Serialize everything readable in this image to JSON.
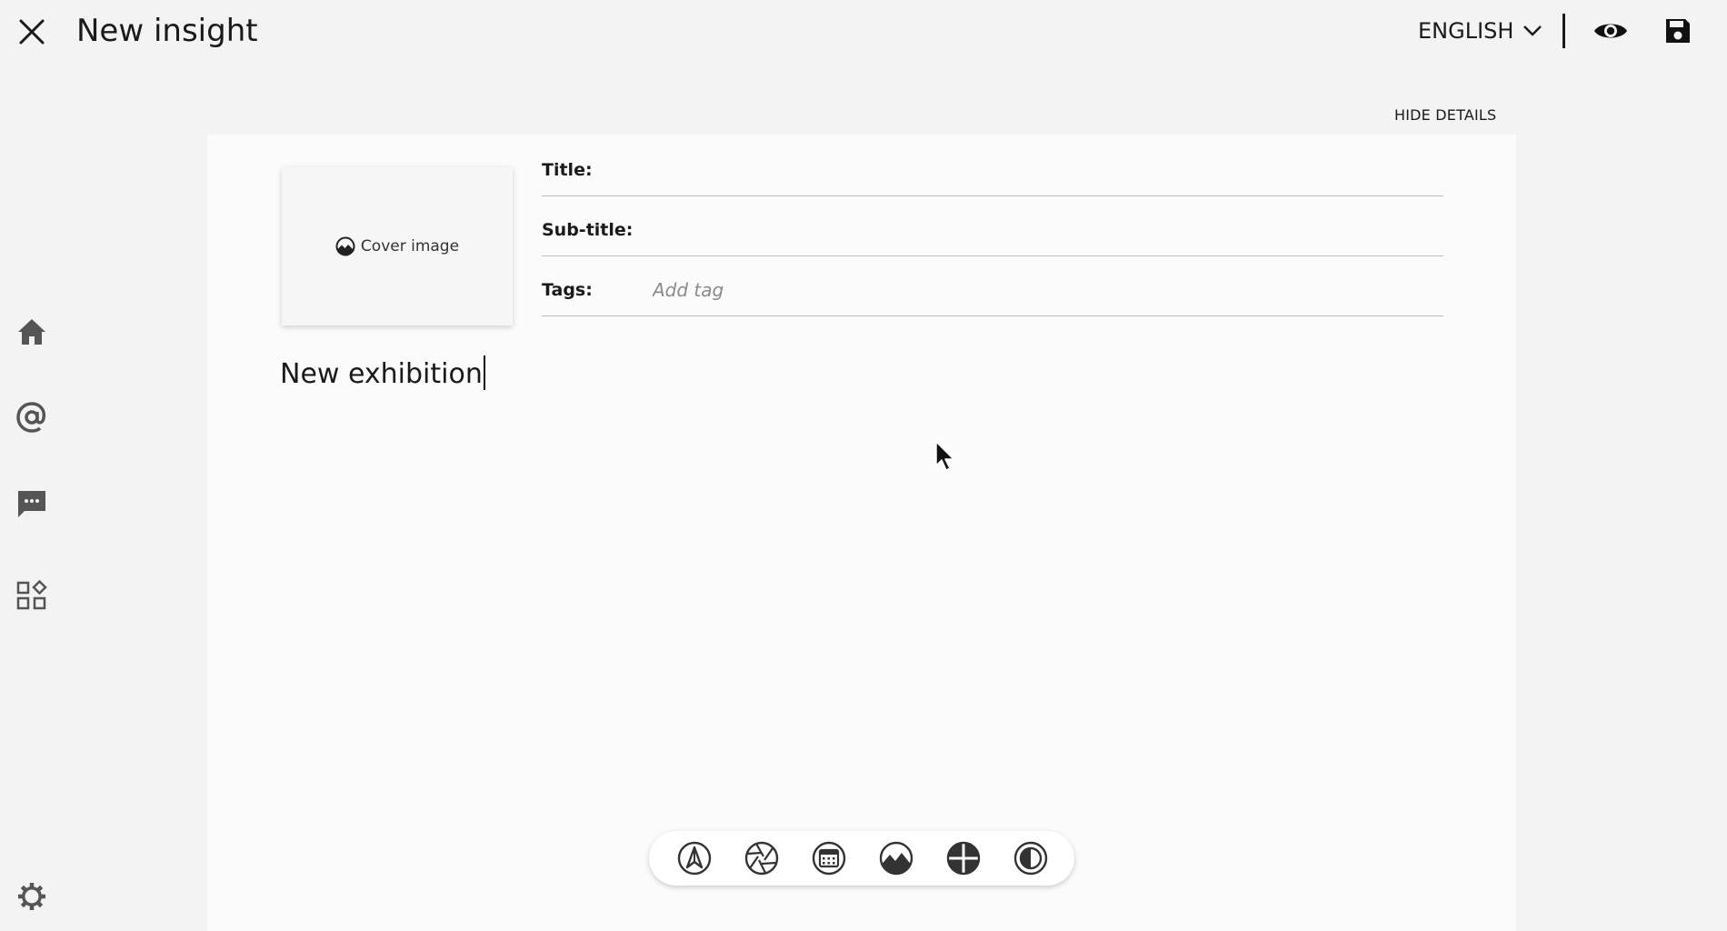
{
  "header": {
    "title": "New insight",
    "language": "ENGLISH",
    "icons": {
      "close": "close-icon",
      "chevron": "chevron-down-icon",
      "preview": "eye-icon",
      "save": "floppy-disk-icon"
    }
  },
  "sidebar": {
    "items": [
      {
        "name": "home",
        "icon": "home-icon"
      },
      {
        "name": "mentions",
        "icon": "at-sign-icon"
      },
      {
        "name": "messages",
        "icon": "chat-bubble-icon"
      },
      {
        "name": "apps",
        "icon": "apps-grid-icon"
      }
    ],
    "settings_icon": "gear-icon"
  },
  "details": {
    "toggle_label": "HIDE DETAILS",
    "cover_label": "Cover image",
    "fields": {
      "title_label": "Title:",
      "title_value": "",
      "subtitle_label": "Sub-title:",
      "subtitle_value": "",
      "tags_label": "Tags:",
      "tags_placeholder": "Add tag"
    }
  },
  "editor": {
    "body_text": "New exhibition"
  },
  "toolbar": {
    "tools": [
      {
        "name": "text-tool",
        "icon": "pen-nib-icon"
      },
      {
        "name": "photo-tool",
        "icon": "aperture-icon"
      },
      {
        "name": "event-tool",
        "icon": "calendar-icon"
      },
      {
        "name": "image-tool",
        "icon": "landscape-icon"
      },
      {
        "name": "layout-tool",
        "icon": "grid-quadrant-icon"
      },
      {
        "name": "contrast-tool",
        "icon": "contrast-icon"
      }
    ]
  },
  "colors": {
    "background": "#f3f3f3",
    "panel": "#fbfbfb",
    "text": "#1a1a1a",
    "icon": "#555555",
    "divider": "#bdbdbd"
  }
}
